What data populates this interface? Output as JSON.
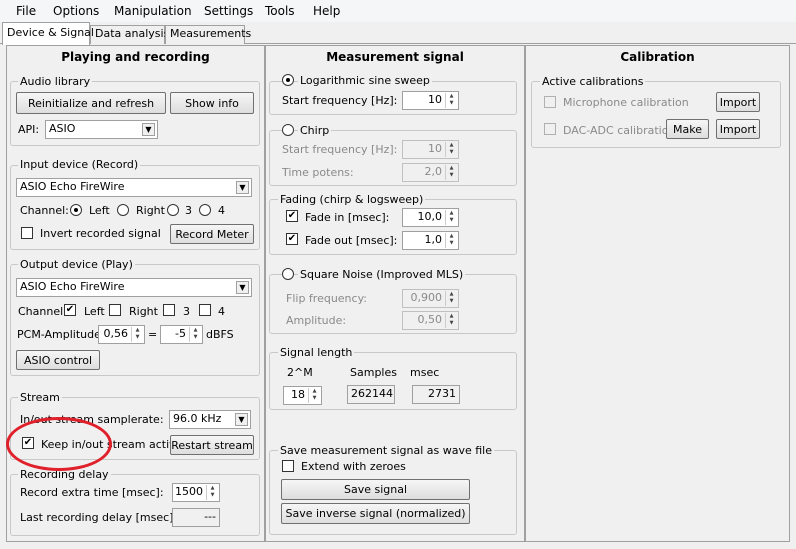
{
  "menu": [
    "File",
    "Options",
    "Manipulation",
    "Settings",
    "Tools",
    "Help"
  ],
  "tabs": [
    "Device & Signal",
    "Data analysis",
    "Measurements"
  ],
  "playing": {
    "title": "Playing and recording",
    "audio_library": {
      "label": "Audio library",
      "reinit_button": "Reinitialize and refresh",
      "show_info_button": "Show info",
      "api_label": "API:",
      "api_value": "ASIO"
    },
    "input_device": {
      "label": "Input device (Record)",
      "device": "ASIO Echo FireWire",
      "channel_label": "Channel:",
      "channels": [
        "Left",
        "Right",
        "3",
        "4"
      ],
      "invert_label": "Invert recorded signal",
      "record_meter_button": "Record Meter"
    },
    "output_device": {
      "label": "Output device (Play)",
      "device": "ASIO Echo FireWire",
      "channel_label": "Channel:",
      "channels": [
        "Left",
        "Right",
        "3",
        "4"
      ],
      "pcm_label": "PCM-Amplitude:",
      "pcm_value": "0,56",
      "equals": "=",
      "dbfs_value": "-5",
      "dbfs_unit": "dBFS",
      "asio_control_button": "ASIO control"
    },
    "stream": {
      "label": "Stream",
      "samplerate_label": "In/out stream samplerate:",
      "samplerate_value": "96.0 kHz",
      "keep_active_label": "Keep in/out stream active",
      "restart_button": "Restart stream"
    },
    "recording_delay": {
      "label": "Recording delay",
      "extra_time_label": "Record extra time [msec]:",
      "extra_time_value": "1500",
      "last_delay_label": "Last recording delay [msec]:",
      "last_delay_value": "---"
    }
  },
  "measurement": {
    "title": "Measurement signal",
    "log_sweep": {
      "label": "Logarithmic sine sweep",
      "start_freq_label": "Start frequency [Hz]:",
      "start_freq_value": "10"
    },
    "chirp": {
      "label": "Chirp",
      "start_freq_label": "Start frequency [Hz]:",
      "start_freq_value": "10",
      "time_potens_label": "Time potens:",
      "time_potens_value": "2,0"
    },
    "fading": {
      "label": "Fading (chirp & logsweep)",
      "fade_in_label": "Fade in [msec]:",
      "fade_in_value": "10,0",
      "fade_out_label": "Fade out [msec]:",
      "fade_out_value": "1,0"
    },
    "square_noise": {
      "label": "Square Noise (Improved MLS)",
      "flip_label": "Flip frequency:",
      "flip_value": "0,900",
      "amplitude_label": "Amplitude:",
      "amplitude_value": "0,50"
    },
    "signal_length": {
      "label": "Signal length",
      "col1": "2^M",
      "col2": "Samples",
      "col3": "msec",
      "m_value": "18",
      "samples_value": "262144",
      "msec_value": "2731"
    },
    "save": {
      "label": "Save measurement signal as wave file",
      "extend_label": "Extend with zeroes",
      "save_button": "Save signal",
      "save_inverse_button": "Save inverse signal (normalized)"
    }
  },
  "calibration": {
    "title": "Calibration",
    "active_label": "Active calibrations",
    "mic_label": "Microphone calibration",
    "dac_label": "DAC-ADC calibration",
    "make_button": "Make",
    "import_button": "Import"
  },
  "colors": {
    "annotation_ellipse": "#e0202a"
  }
}
